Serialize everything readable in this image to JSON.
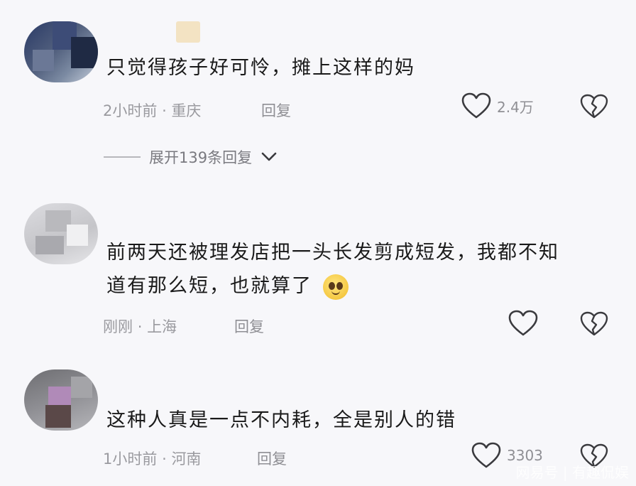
{
  "comments": [
    {
      "text": "只觉得孩子好可怜，摊上这样的妈",
      "time": "2小时前",
      "location": "重庆",
      "reply_label": "回复",
      "like_count": "2.4万",
      "expand_label": "展开139条回复"
    },
    {
      "text_line1": "前两天还被理发店把一头长发剪成短发，我都不知",
      "text_line2": "道有那么短，也就算了",
      "time": "刚刚",
      "location": "上海",
      "reply_label": "回复",
      "like_count": ""
    },
    {
      "text": "这种人真是一点不内耗，全是别人的错",
      "time": "1小时前",
      "location": "河南",
      "reply_label": "回复",
      "like_count": "3303"
    }
  ],
  "meta_separator": "·",
  "watermark": "网易号 | 有趣侃娱",
  "colors": {
    "background": "#f7f7fa",
    "text": "#1a1a1a",
    "meta": "#9a9a9f",
    "icon": "#3a3a3e"
  },
  "icons": [
    "heart-outline-icon",
    "broken-heart-icon",
    "chevron-down-icon",
    "crying-emoji-icon"
  ]
}
